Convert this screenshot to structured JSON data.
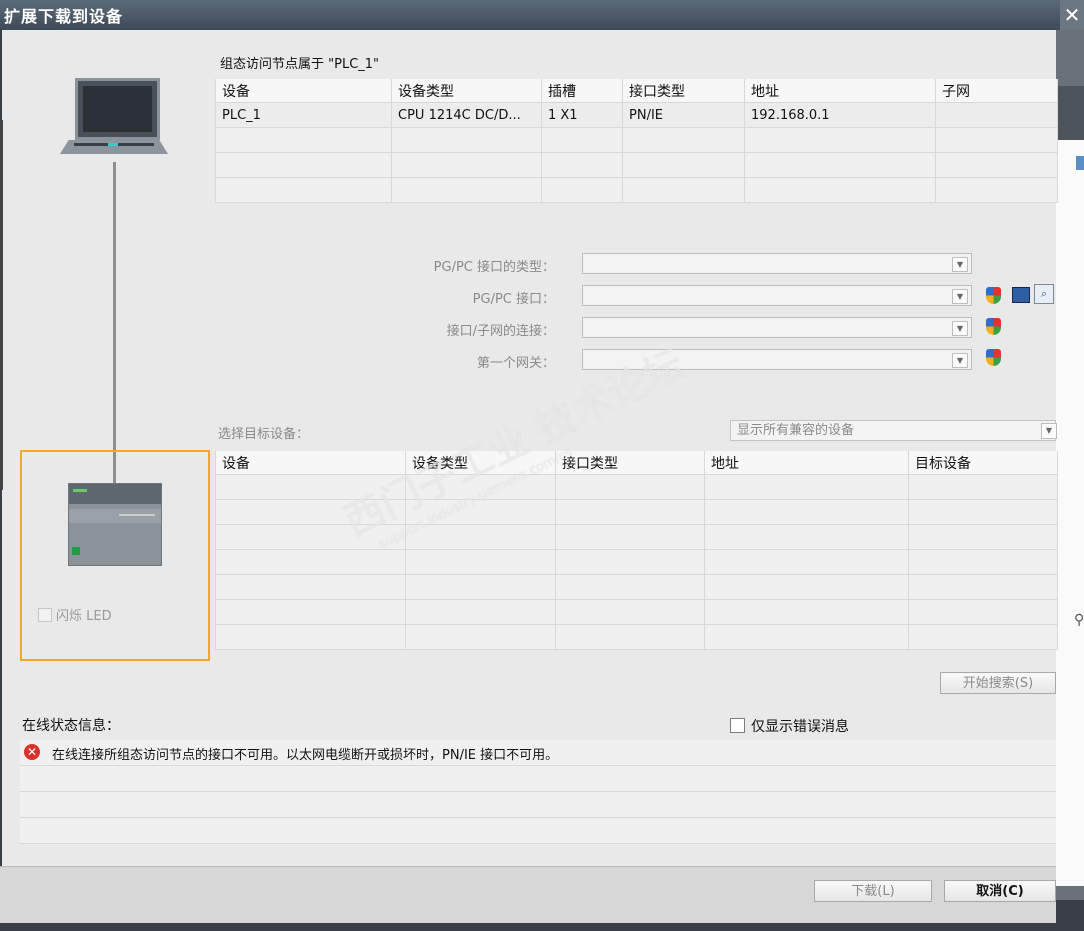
{
  "window": {
    "title": "扩展下载到设备",
    "close_label": "✕"
  },
  "config_section": {
    "heading": "组态访问节点属于 \"PLC_1\"",
    "columns": [
      "设备",
      "设备类型",
      "插槽",
      "接口类型",
      "地址",
      "子网"
    ],
    "rows": [
      [
        "PLC_1",
        "CPU 1214C DC/D...",
        "1 X1",
        "PN/IE",
        "192.168.0.1",
        ""
      ]
    ]
  },
  "interface_form": {
    "pgpc_type_label": "PG/PC 接口的类型：",
    "pgpc_interface_label": "PG/PC 接口：",
    "subnet_conn_label": "接口/子网的连接：",
    "first_gateway_label": "第一个网关："
  },
  "target_section": {
    "heading": "选择目标设备：",
    "filter_value": "显示所有兼容的设备",
    "columns": [
      "设备",
      "设备类型",
      "接口类型",
      "地址",
      "目标设备"
    ]
  },
  "left_panel": {
    "flash_led_label": "闪烁 LED"
  },
  "buttons": {
    "start_search": "开始搜索(S)",
    "download": "下载(L)",
    "cancel": "取消(C)"
  },
  "status": {
    "heading": "在线状态信息：",
    "only_errors_label": "仅显示错误消息",
    "messages": [
      "在线连接所组态访问节点的接口不可用。以太网电缆断开或损坏时，PN/IE 接口不可用。"
    ]
  },
  "watermark": {
    "text": "西门子工业 技术论坛",
    "url": "support.industry.siemens.com/cs"
  },
  "icons": [
    "shield-icon",
    "monitor-icon",
    "search-icon",
    "error-icon",
    "close-icon"
  ]
}
